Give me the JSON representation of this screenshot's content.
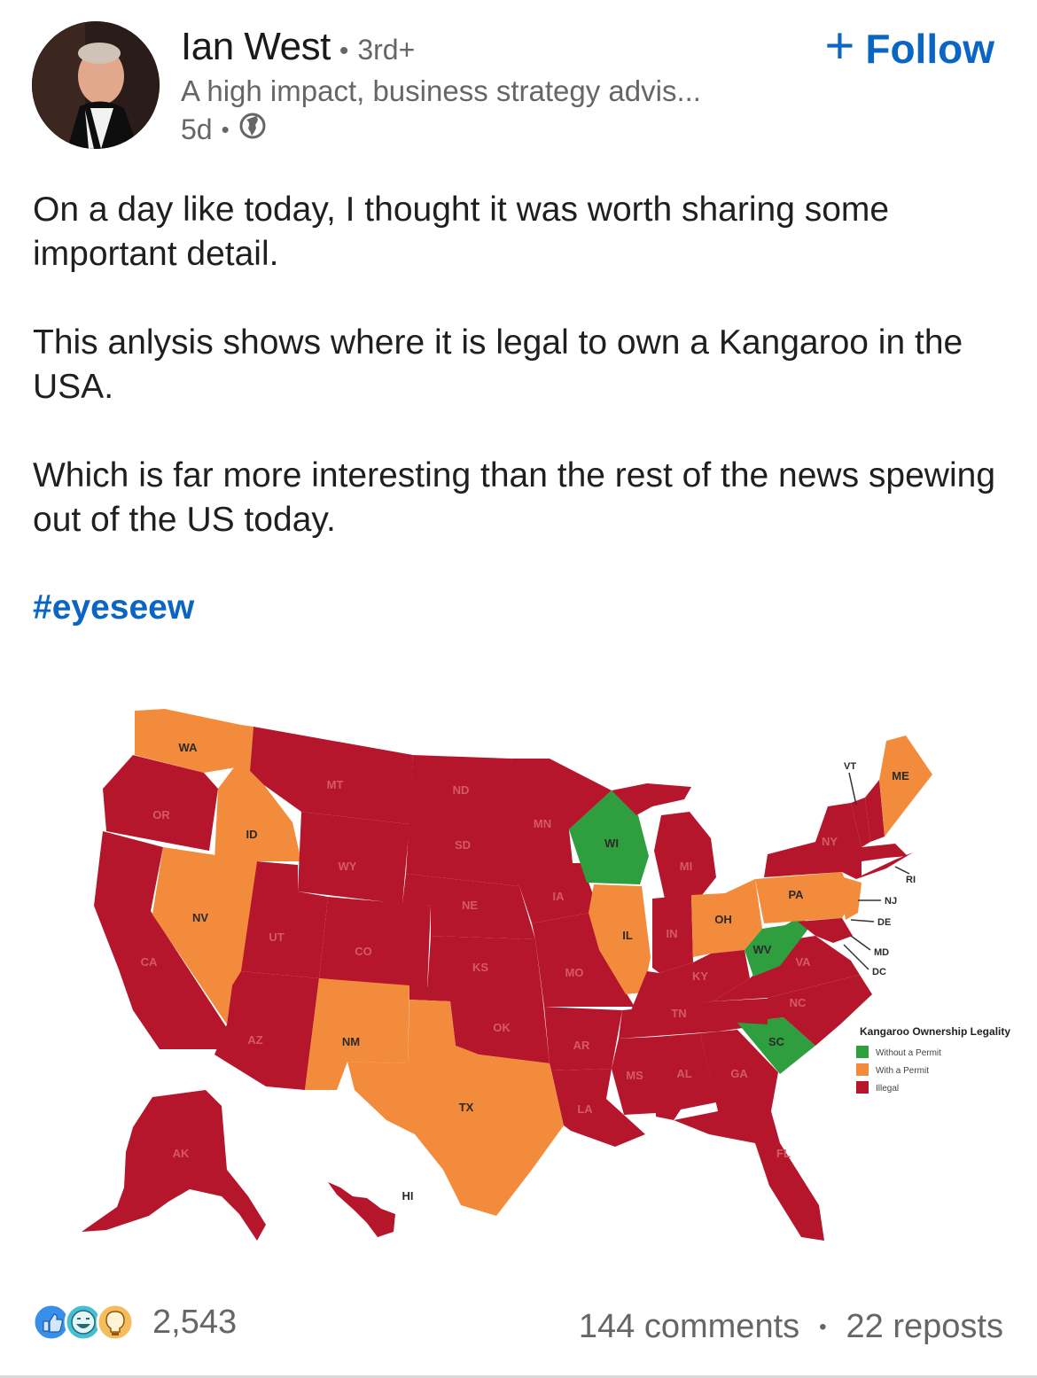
{
  "author": {
    "name": "Ian West",
    "degree": "3rd+",
    "headline": "A high impact, business strategy advis...",
    "time": "5d",
    "follow_label": "Follow",
    "visibility_icon": "globe-icon"
  },
  "post": {
    "paragraphs": [
      "On a day like today, I thought it was worth sharing some important detail.",
      "This anlysis shows where it is legal to own a Kangaroo in the USA.",
      "Which is far more interesting than the rest of the news spewing out of the US today."
    ],
    "hashtag": "#eyeseew"
  },
  "map": {
    "legend_title": "Kangaroo Ownership Legality",
    "legend": [
      {
        "label": "Without a Permit",
        "color": "#2e9e3e"
      },
      {
        "label": "With a Permit",
        "color": "#f28c3c"
      },
      {
        "label": "Illegal",
        "color": "#b5162b"
      }
    ],
    "states": {
      "without_permit": [
        "WI",
        "WV",
        "SC"
      ],
      "with_permit": [
        "WA",
        "ID",
        "NV",
        "NM",
        "TX",
        "IL",
        "OH",
        "PA",
        "ME",
        "NJ"
      ],
      "illegal": [
        "OR",
        "CA",
        "MT",
        "WY",
        "UT",
        "CO",
        "AZ",
        "ND",
        "SD",
        "NE",
        "KS",
        "OK",
        "MN",
        "IA",
        "MO",
        "AR",
        "LA",
        "MI",
        "IN",
        "KY",
        "TN",
        "MS",
        "AL",
        "GA",
        "FL",
        "NC",
        "VA",
        "NY",
        "VT",
        "RI",
        "DE",
        "MD",
        "DC",
        "AK",
        "HI"
      ]
    },
    "labels": {
      "WA": "WA",
      "OR": "OR",
      "CA": "CA",
      "ID": "ID",
      "NV": "NV",
      "MT": "MT",
      "WY": "WY",
      "UT": "UT",
      "CO": "CO",
      "AZ": "AZ",
      "NM": "NM",
      "ND": "ND",
      "SD": "SD",
      "NE": "NE",
      "KS": "KS",
      "OK": "OK",
      "TX": "TX",
      "MN": "MN",
      "IA": "IA",
      "MO": "MO",
      "AR": "AR",
      "LA": "LA",
      "WI": "WI",
      "IL": "IL",
      "MI": "MI",
      "IN": "IN",
      "OH": "OH",
      "KY": "KY",
      "TN": "TN",
      "MS": "MS",
      "AL": "AL",
      "GA": "GA",
      "FL": "FL",
      "SC": "SC",
      "NC": "NC",
      "VA": "VA",
      "WV": "WV",
      "PA": "PA",
      "NY": "NY",
      "ME": "ME",
      "VT": "VT",
      "NJ": "NJ",
      "RI": "RI",
      "DE": "DE",
      "MD": "MD",
      "DC": "DC",
      "AK": "AK",
      "HI": "HI"
    }
  },
  "social": {
    "reaction_count": "2,543",
    "comments": "144 comments",
    "separator": "•",
    "reposts": "22 reposts",
    "reaction_icons": [
      "like-icon",
      "funny-icon",
      "insightful-icon"
    ]
  }
}
